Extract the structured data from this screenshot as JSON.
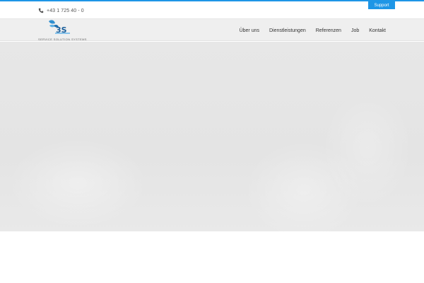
{
  "colors": {
    "accent": "#1e96e6",
    "header_bg": "#efefef",
    "hero_bg": "#e6e6e6"
  },
  "topbar": {
    "phone_icon": "phone-icon",
    "phone": "+43 1 725 40 - 0",
    "support_label": "Support"
  },
  "header": {
    "logo_icon": "butterfly-logo-icon",
    "logo_text": "SERVICE SOLUTION SYSTEMS",
    "nav": [
      {
        "label": "Über uns"
      },
      {
        "label": "Dienstleistungen"
      },
      {
        "label": "Referenzen"
      },
      {
        "label": "Job"
      },
      {
        "label": "Kontakt"
      }
    ]
  }
}
